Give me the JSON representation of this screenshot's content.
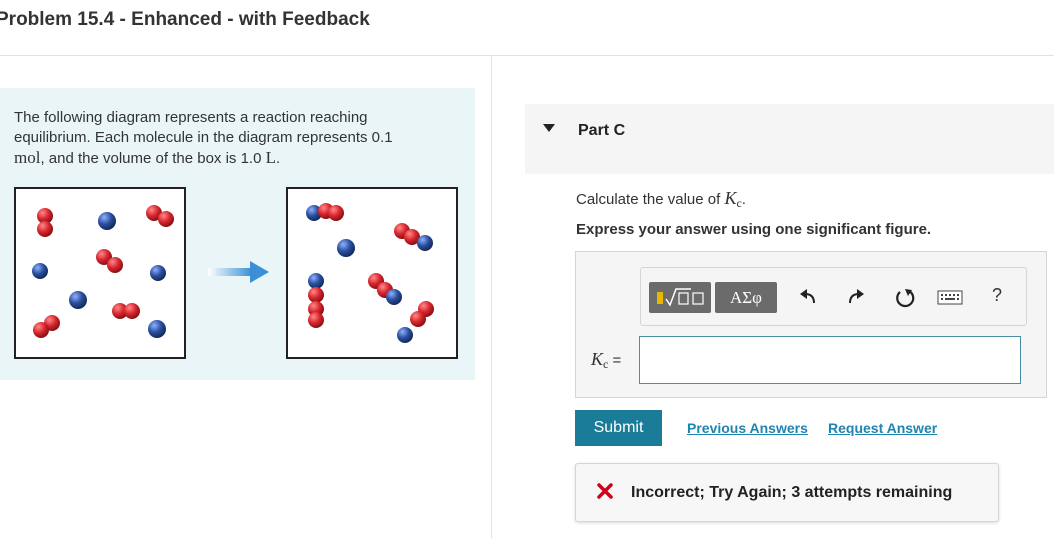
{
  "page_title": "Problem 15.4 - Enhanced - with Feedback",
  "intro": {
    "line1": "The following diagram represents a reaction reaching",
    "line2": "equilibrium. Each molecule in the diagram represents 0.1",
    "unit_mol": "mol",
    "line3_mid": ", and the volume of the box is 1.0 ",
    "unit_L": "L",
    "line3_end": "."
  },
  "part": {
    "label": "Part C"
  },
  "question": {
    "text": "Calculate the value of ",
    "var": "K",
    "sub": "c",
    "end": ".",
    "instruction": "Express your answer using one significant figure."
  },
  "toolbar": {
    "greek_label": "ΑΣφ",
    "help_label": "?"
  },
  "answer": {
    "var": "K",
    "sub": "c",
    "equals": " =",
    "value": ""
  },
  "buttons": {
    "submit": "Submit",
    "previous_answers": "Previous Answers",
    "request_answer": "Request Answer"
  },
  "feedback": {
    "text": "Incorrect; Try Again; 3 attempts remaining",
    "color": "#d0021b"
  },
  "colors": {
    "red_atom": "#d8262e",
    "blue_atom": "#2a4f9e",
    "accent": "#1a7c98",
    "link": "#1e84b0",
    "panel_bg": "#e9f5f7"
  }
}
